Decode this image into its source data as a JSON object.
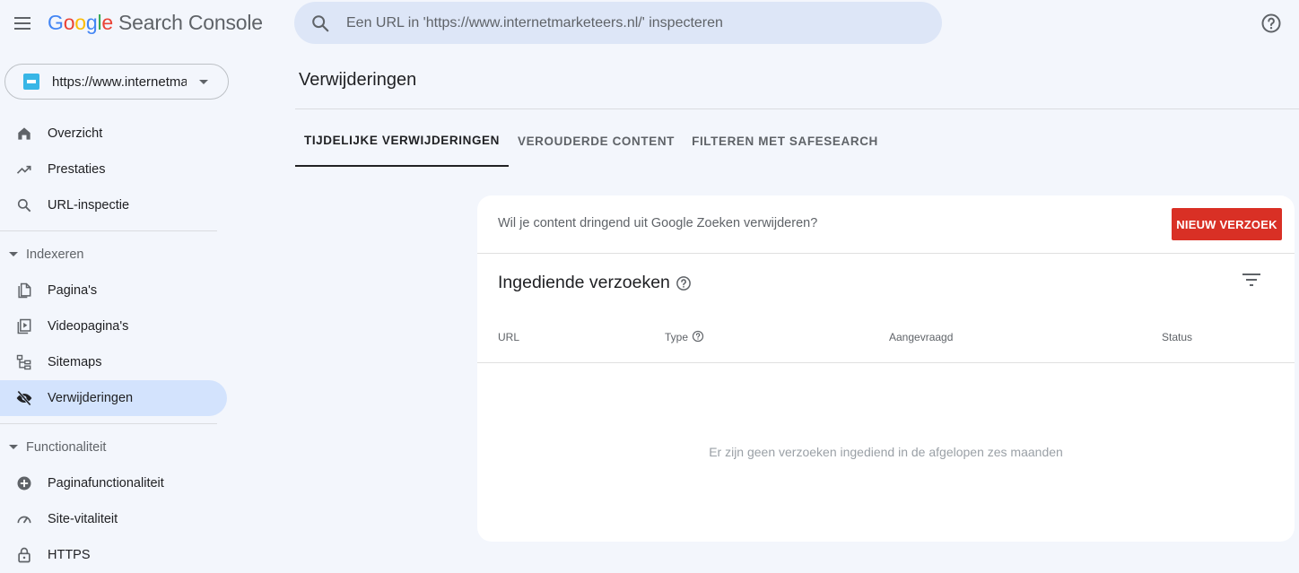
{
  "app": {
    "logo_letters": [
      "G",
      "o",
      "o",
      "g",
      "l",
      "e"
    ],
    "product_name": "Search Console"
  },
  "search": {
    "placeholder": "Een URL in 'https://www.internetmarketeers.nl/' inspecteren",
    "value": ""
  },
  "property": {
    "label": "https://www.internetmarketeers.nl/"
  },
  "sidebar": {
    "items_top": [
      {
        "label": "Overzicht",
        "icon": "home-icon"
      },
      {
        "label": "Prestaties",
        "icon": "trending-up-icon"
      },
      {
        "label": "URL-inspectie",
        "icon": "search-icon"
      }
    ],
    "sections": [
      {
        "label": "Indexeren",
        "items": [
          {
            "label": "Pagina's",
            "icon": "pages-icon"
          },
          {
            "label": "Videopagina's",
            "icon": "video-pages-icon"
          },
          {
            "label": "Sitemaps",
            "icon": "sitemap-icon"
          },
          {
            "label": "Verwijderingen",
            "icon": "eye-off-icon",
            "active": true
          }
        ]
      },
      {
        "label": "Functionaliteit",
        "items": [
          {
            "label": "Paginafunctionaliteit",
            "icon": "plus-circle-icon"
          },
          {
            "label": "Site-vitaliteit",
            "icon": "gauge-icon"
          },
          {
            "label": "HTTPS",
            "icon": "lock-icon"
          }
        ]
      }
    ]
  },
  "main": {
    "title": "Verwijderingen",
    "tabs": [
      {
        "label": "TIJDELIJKE VERWIJDERINGEN",
        "active": true
      },
      {
        "label": "VEROUDERDE CONTENT",
        "active": false
      },
      {
        "label": "FILTEREN MET SAFESEARCH",
        "active": false
      }
    ],
    "card": {
      "prompt": "Wil je content dringend uit Google Zoeken verwijderen?",
      "new_request_label": "NIEUW VERZOEK",
      "section_title": "Ingediende verzoeken",
      "columns": [
        "URL",
        "Type",
        "Aangevraagd",
        "Status"
      ],
      "empty_message": "Er zijn geen verzoeken ingediend in de afgelopen zes maanden"
    }
  },
  "colors": {
    "background": "#f3f6fc",
    "search_bg": "#dde6f7",
    "active_nav_bg": "#d3e3fd",
    "primary_button": "#d93025",
    "text": "#202124",
    "muted_text": "#5f6368"
  }
}
